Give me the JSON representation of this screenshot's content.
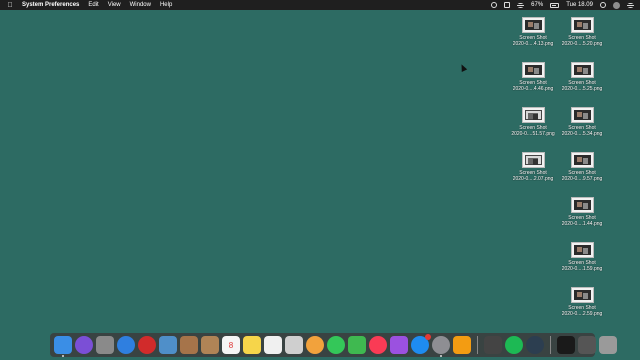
{
  "menubar": {
    "app_name": "System Preferences",
    "menus": [
      "Edit",
      "View",
      "Window",
      "Help"
    ],
    "battery_percent": "67%",
    "clock": "Tue 18.09"
  },
  "desktop_files": [
    {
      "line1": "Screen Shot",
      "line2": "2020-0....4.13.png",
      "style": "dark"
    },
    {
      "line1": "Screen Shot",
      "line2": "2020-0....5.20.png",
      "style": "dark"
    },
    {
      "line1": "Screen Shot",
      "line2": "2020-0....4.46.png",
      "style": "dark"
    },
    {
      "line1": "Screen Shot",
      "line2": "2020-0....5.25.png",
      "style": "dark"
    },
    {
      "line1": "Screen Shot",
      "line2": "2020-0....51.57.png",
      "style": "light"
    },
    {
      "line1": "Screen Shot",
      "line2": "2020-0....5.34.png",
      "style": "dark"
    },
    {
      "line1": "Screen Shot",
      "line2": "2020-0....2.07.png",
      "style": "light"
    },
    {
      "line1": "Screen Shot",
      "line2": "2020-0....9.57.png",
      "style": "dark"
    },
    {
      "line1": "Screen Shot",
      "line2": "2020-0....1.44.png",
      "style": "dark"
    },
    {
      "line1": "Screen Shot",
      "line2": "2020-0....1.59.png",
      "style": "dark"
    },
    {
      "line1": "Screen Shot",
      "line2": "2020-0....2.59.png",
      "style": "dark"
    }
  ],
  "dock": {
    "apps": [
      {
        "name": "finder-icon",
        "color": "#3a8ee6",
        "running": true
      },
      {
        "name": "siri-icon",
        "color": "#7b4fd6",
        "running": false
      },
      {
        "name": "launchpad-icon",
        "color": "#8a8a8a",
        "running": false
      },
      {
        "name": "safari-icon",
        "color": "#2f7fe0",
        "running": false
      },
      {
        "name": "opera-icon",
        "color": "#d12b2b",
        "running": false
      },
      {
        "name": "preview-icon",
        "color": "#4f8fc9",
        "running": false
      },
      {
        "name": "notefile-icon",
        "color": "#a6744a",
        "running": false
      },
      {
        "name": "contacts-icon",
        "color": "#b08456",
        "running": false
      },
      {
        "name": "calendar-icon",
        "color": "#f5f5f5",
        "running": false
      },
      {
        "name": "notes-icon",
        "color": "#f6d54a",
        "running": false
      },
      {
        "name": "reminders-icon",
        "color": "#f0f0f0",
        "running": false
      },
      {
        "name": "mail-icon",
        "color": "#cfcfcf",
        "running": false
      },
      {
        "name": "photos-icon",
        "color": "#f2a23c",
        "running": false
      },
      {
        "name": "messages-icon",
        "color": "#34c759",
        "running": false
      },
      {
        "name": "facetime-icon",
        "color": "#3fb950",
        "running": false
      },
      {
        "name": "music-icon",
        "color": "#fa3b55",
        "running": false
      },
      {
        "name": "podcasts-icon",
        "color": "#9b51e0",
        "running": false
      },
      {
        "name": "app-store-icon",
        "color": "#1e8cf0",
        "badge": true,
        "running": false
      },
      {
        "name": "system-preferences-icon",
        "color": "#8e8e93",
        "running": true
      },
      {
        "name": "pages-icon",
        "color": "#f39c12",
        "running": false
      }
    ],
    "apps2": [
      {
        "name": "inkscape-icon",
        "color": "#444444",
        "running": false
      },
      {
        "name": "spotify-icon",
        "color": "#1db954",
        "running": false
      },
      {
        "name": "quicktime-icon",
        "color": "#2c3e50",
        "running": false
      }
    ],
    "apps3": [
      {
        "name": "phone-mirror-icon",
        "color": "#1a1a1a",
        "running": false
      },
      {
        "name": "window-icon",
        "color": "#555555",
        "running": false
      },
      {
        "name": "trash-icon",
        "color": "#9a9a9a",
        "running": false
      }
    ],
    "calendar_day": "8"
  }
}
